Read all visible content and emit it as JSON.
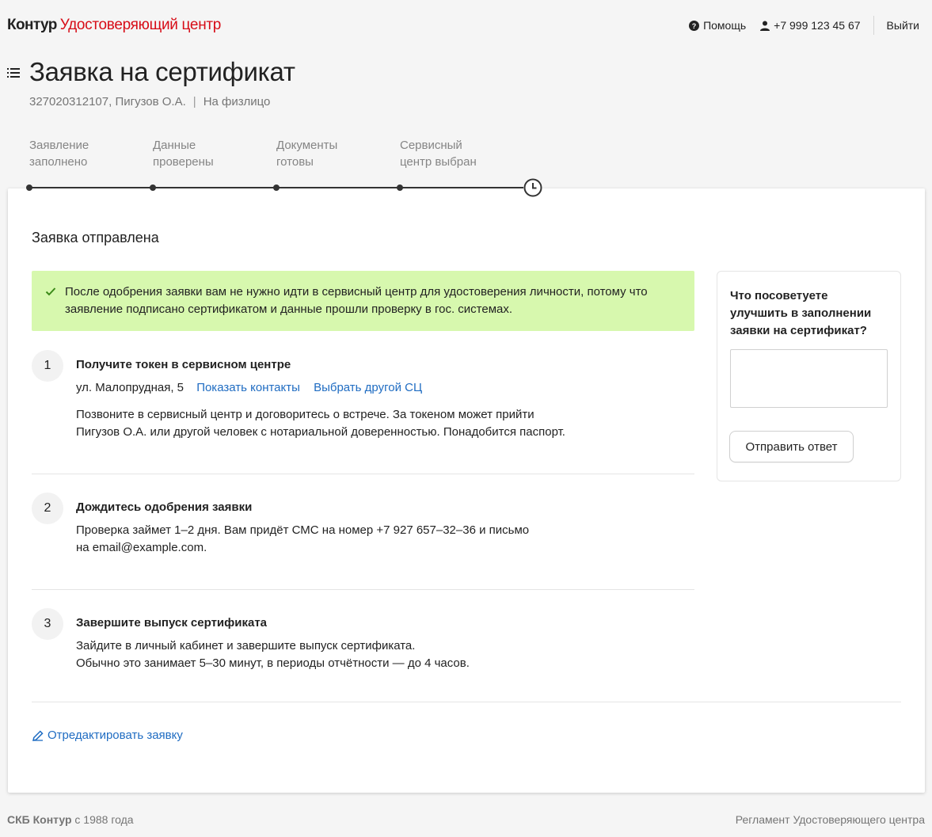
{
  "header": {
    "brand": "Контур",
    "product": "Удостоверяющий центр",
    "help_label": "Помощь",
    "phone": "+7 999 123 45 67",
    "logout_label": "Выйти"
  },
  "page": {
    "title": "Заявка на сертификат",
    "subtitle_id": "327020312107, Пигузов О.А.",
    "subtitle_sep": "|",
    "subtitle_type": "На физлицо"
  },
  "stepper": {
    "steps": [
      {
        "line1": "Заявление",
        "line2": "заполнено"
      },
      {
        "line1": "Данные",
        "line2": "проверены"
      },
      {
        "line1": "Документы",
        "line2": "готовы"
      },
      {
        "line1": "Сервисный",
        "line2": "центр выбран"
      }
    ]
  },
  "card": {
    "title": "Заявка отправлена",
    "success_text": "После одобрения заявки вам не нужно идти в сервисный центр для удостоверения личности, потому что заявление подписано сертификатом и данные прошли проверку в гос. системах.",
    "steps": [
      {
        "num": "1",
        "title": "Получите токен в сервисном центре",
        "address": "ул. Малопрудная, 5",
        "show_contacts": "Показать контакты",
        "choose_other": "Выбрать другой СЦ",
        "text_line1": "Позвоните в сервисный центр и договоритесь о встрече. За токеном может прийти",
        "text_line2": "Пигузов О.А. или другой человек с нотариальной доверенностью. Понадобится паспорт."
      },
      {
        "num": "2",
        "title": "Дождитесь одобрения заявки",
        "text_line1": "Проверка займет 1–2 дня. Вам придёт СМС на номер +7 927 657–32–36 и письмо",
        "text_line2": "на email@example.com."
      },
      {
        "num": "3",
        "title": "Завершите выпуск сертификата",
        "text_line1": "Зайдите в личный кабинет и завершите выпуск сертификата.",
        "text_line2": "Обычно это занимает 5–30 минут, в периоды отчётности — до 4 часов."
      }
    ],
    "edit_label": "Отредактировать заявку"
  },
  "feedback": {
    "question": "Что посоветуете улучшить в заполнении заявки на сертификат?",
    "textarea_value": "",
    "submit_label": "Отправить ответ"
  },
  "footer": {
    "company": "СКБ Контур",
    "since": "с 1988 года",
    "regulation": "Регламент Удостоверяющего центра"
  },
  "colors": {
    "brand_red": "#d70c17",
    "link_blue": "#1f6cc2",
    "success_bg": "#d7f8ae"
  }
}
